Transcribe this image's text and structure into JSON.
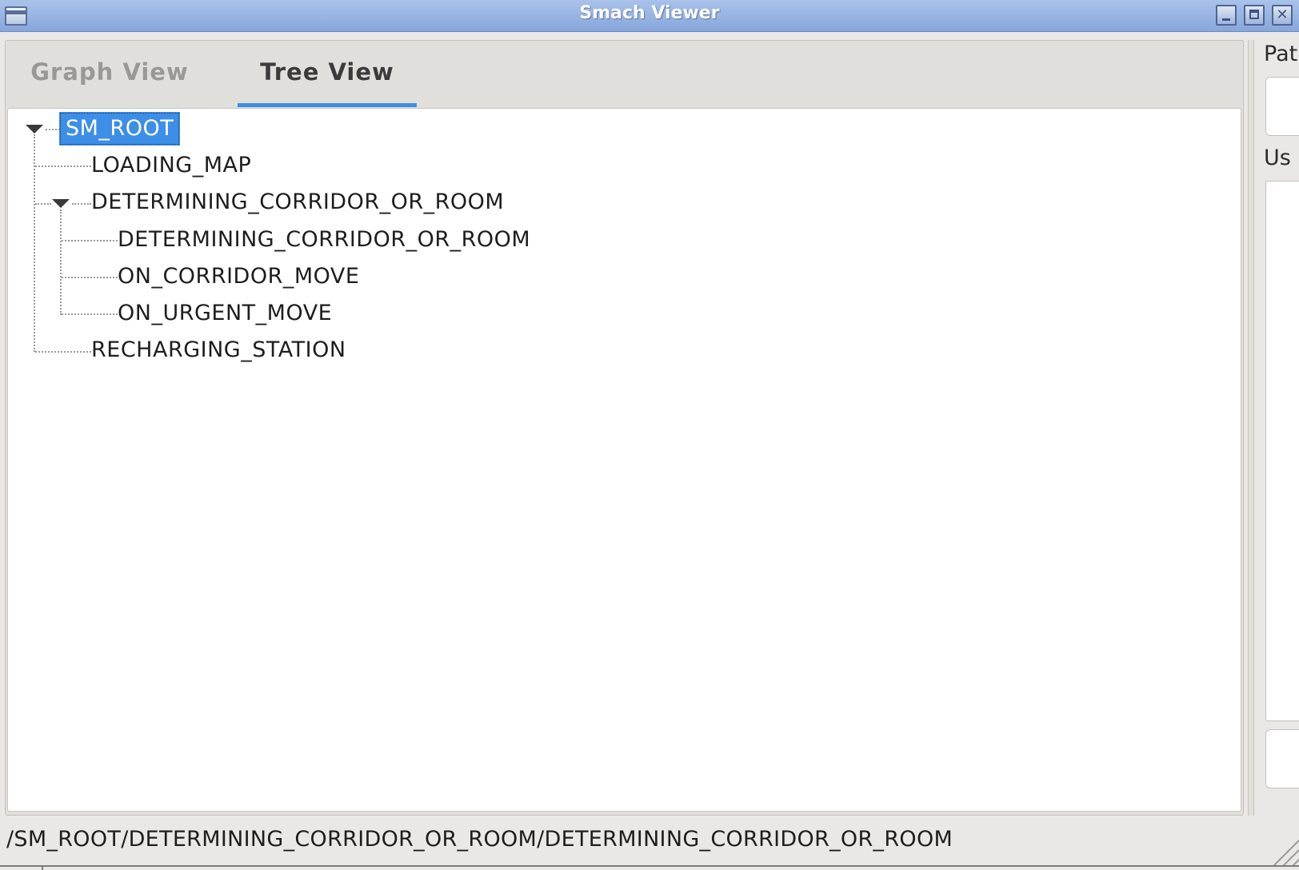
{
  "window": {
    "title": "Smach Viewer",
    "controls": [
      "minimize",
      "maximize",
      "close"
    ]
  },
  "tabs": [
    {
      "label": "Graph View",
      "active": false
    },
    {
      "label": "Tree View",
      "active": true
    }
  ],
  "tree": {
    "root": {
      "label": "SM_ROOT",
      "expanded": true,
      "selected": true
    },
    "items": [
      {
        "label": "LOADING_MAP"
      },
      {
        "label": "DETERMINING_CORRIDOR_OR_ROOM",
        "expanded": true
      },
      {
        "label": "DETERMINING_CORRIDOR_OR_ROOM"
      },
      {
        "label": "ON_CORRIDOR_MOVE"
      },
      {
        "label": "ON_URGENT_MOVE"
      },
      {
        "label": "RECHARGING_STATION"
      }
    ]
  },
  "right_panel": {
    "path_label": "Pat",
    "user_label": "Us"
  },
  "status": {
    "path": "/SM_ROOT/DETERMINING_CORRIDOR_OR_ROOM/DETERMINING_CORRIDOR_OR_ROOM"
  },
  "colors": {
    "accent": "#3d8ee6",
    "titlebar": "#95b2e2"
  }
}
